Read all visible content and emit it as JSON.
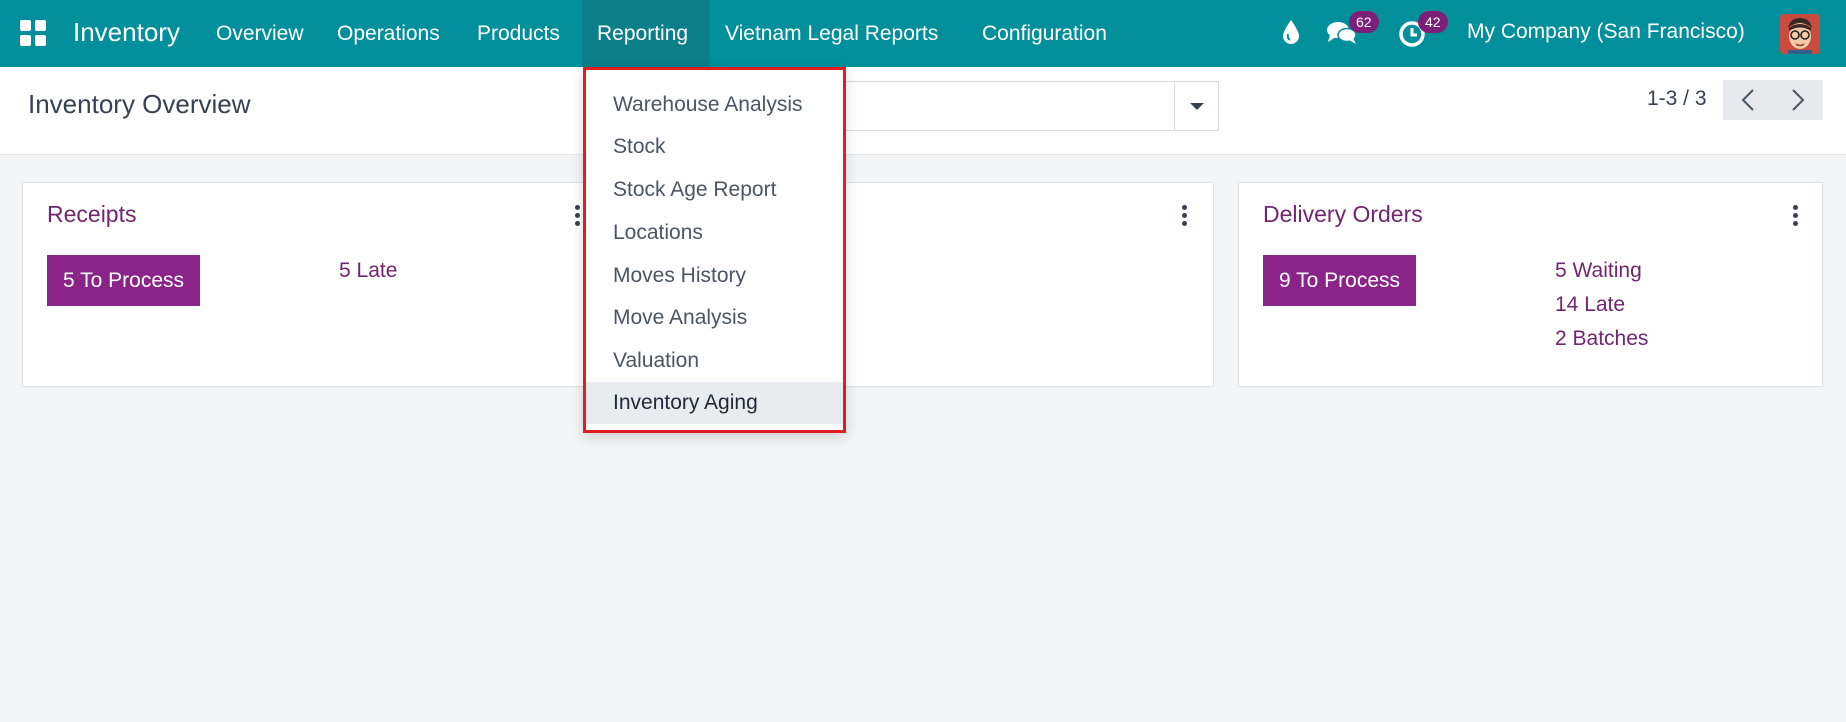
{
  "navbar": {
    "app_name": "Inventory",
    "menu": [
      "Overview",
      "Operations",
      "Products",
      "Reporting",
      "Vietnam Legal Reports",
      "Configuration"
    ],
    "messages_count": "62",
    "activities_count": "42",
    "company": "My Company (San Francisco)"
  },
  "control_panel": {
    "title": "Inventory Overview",
    "pager": "1-3 / 3"
  },
  "reporting_menu": {
    "items": [
      "Warehouse Analysis",
      "Stock",
      "Stock Age Report",
      "Locations",
      "Moves History",
      "Move Analysis",
      "Valuation",
      "Inventory Aging"
    ],
    "hovered": "Inventory Aging"
  },
  "cards": {
    "receipts": {
      "title": "Receipts",
      "process_label": "5 To Process",
      "late": "5 Late"
    },
    "delivery": {
      "title": "Delivery Orders",
      "process_label": "9 To Process",
      "waiting": "5 Waiting",
      "late": "14 Late",
      "batches": "2 Batches"
    }
  },
  "colors": {
    "navbar": "#028f9c",
    "accent": "#71256f",
    "button": "#8a2488",
    "highlight_border": "#e11d24"
  }
}
